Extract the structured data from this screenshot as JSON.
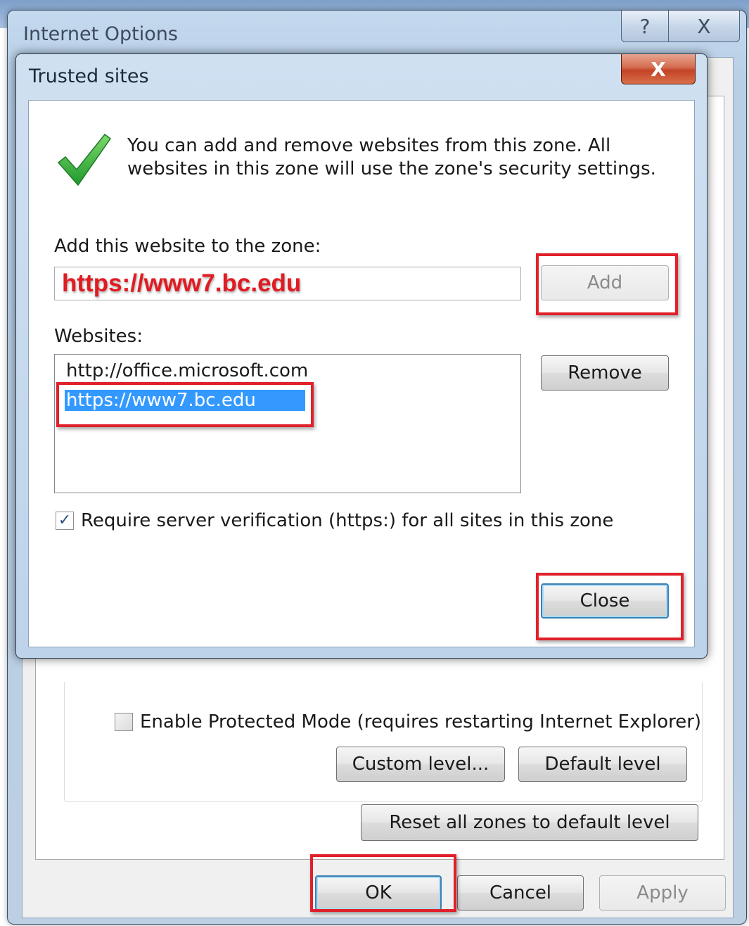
{
  "internet_options": {
    "title": "Internet Options",
    "help_glyph": "?",
    "close_glyph": "X",
    "protected_mode": {
      "label": "Enable Protected Mode (requires restarting Internet Explorer)",
      "checked": false
    },
    "custom_level_label": "Custom level...",
    "default_level_label": "Default level",
    "reset_zones_label": "Reset all zones to default level",
    "ok_label": "OK",
    "cancel_label": "Cancel",
    "apply_label": "Apply"
  },
  "trusted_sites": {
    "title": "Trusted sites",
    "close_glyph": "X",
    "intro": "You can add and remove websites from this zone. All websites in this zone will use the zone's security settings.",
    "add_label_text": "Add this website to the zone:",
    "add_input_value": "https://www7.bc.edu",
    "add_button_label": "Add",
    "websites_label": "Websites:",
    "websites": [
      {
        "url": "http://office.microsoft.com",
        "selected": false
      },
      {
        "url": "https://www7.bc.edu",
        "selected": true
      }
    ],
    "remove_button_label": "Remove",
    "require_verification": {
      "label": "Require server verification (https:) for all sites in this zone",
      "checked": true
    },
    "close_button_label": "Close"
  },
  "colors": {
    "highlight_box": "#e0202a",
    "selection": "#3399ff",
    "input_text": "#e11b22",
    "check_icon": "#3cb043"
  }
}
